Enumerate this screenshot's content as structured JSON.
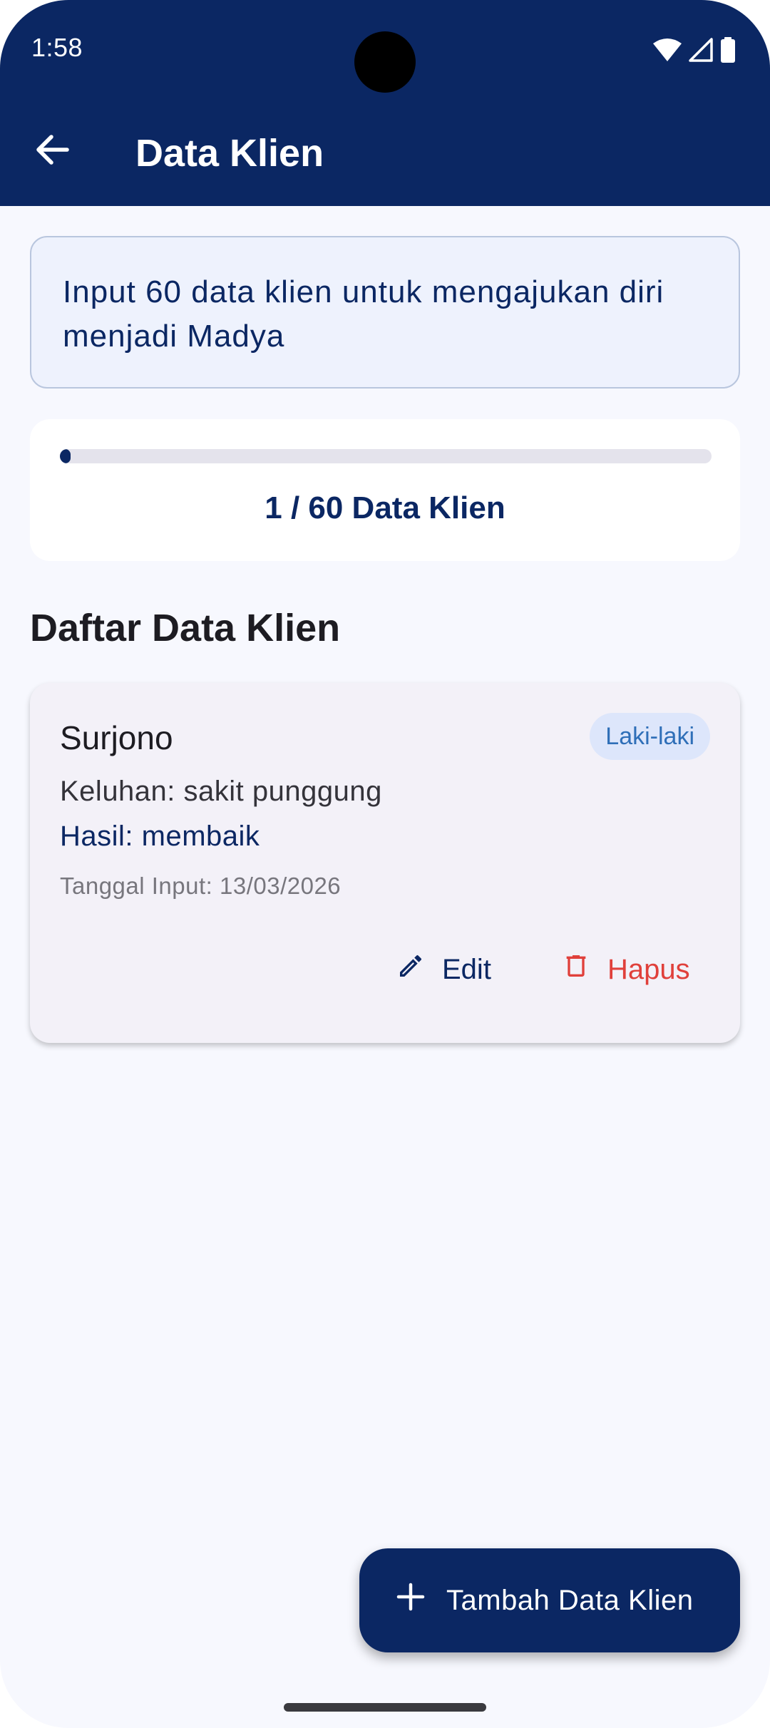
{
  "status_bar": {
    "time": "1:58"
  },
  "app_bar": {
    "title": "Data Klien",
    "back_icon": "arrow-back-icon",
    "background_color": "#0b2763"
  },
  "info_card": {
    "message": "Input 60 data klien untuk mengajukan diri menjadi Madya"
  },
  "progress": {
    "label": "1 / 60 Data Klien",
    "current": 1,
    "target": 60,
    "fraction": 0.0167
  },
  "section": {
    "title": "Daftar Data Klien"
  },
  "clients": [
    {
      "name": "Surjono",
      "gender": "Laki-laki",
      "complaint": "Keluhan: sakit punggung",
      "result": "Hasil: membaik",
      "date": "Tanggal Input: 13/03/2026",
      "edit_label": "Edit",
      "delete_label": "Hapus",
      "edit_icon": "pencil-icon",
      "delete_icon": "trash-icon"
    }
  ],
  "fab": {
    "label": "Tambah Data Klien",
    "icon": "plus-icon"
  },
  "colors": {
    "primary": "#0b2763",
    "danger": "#e0403b",
    "badge_text": "#2f6fb8"
  }
}
